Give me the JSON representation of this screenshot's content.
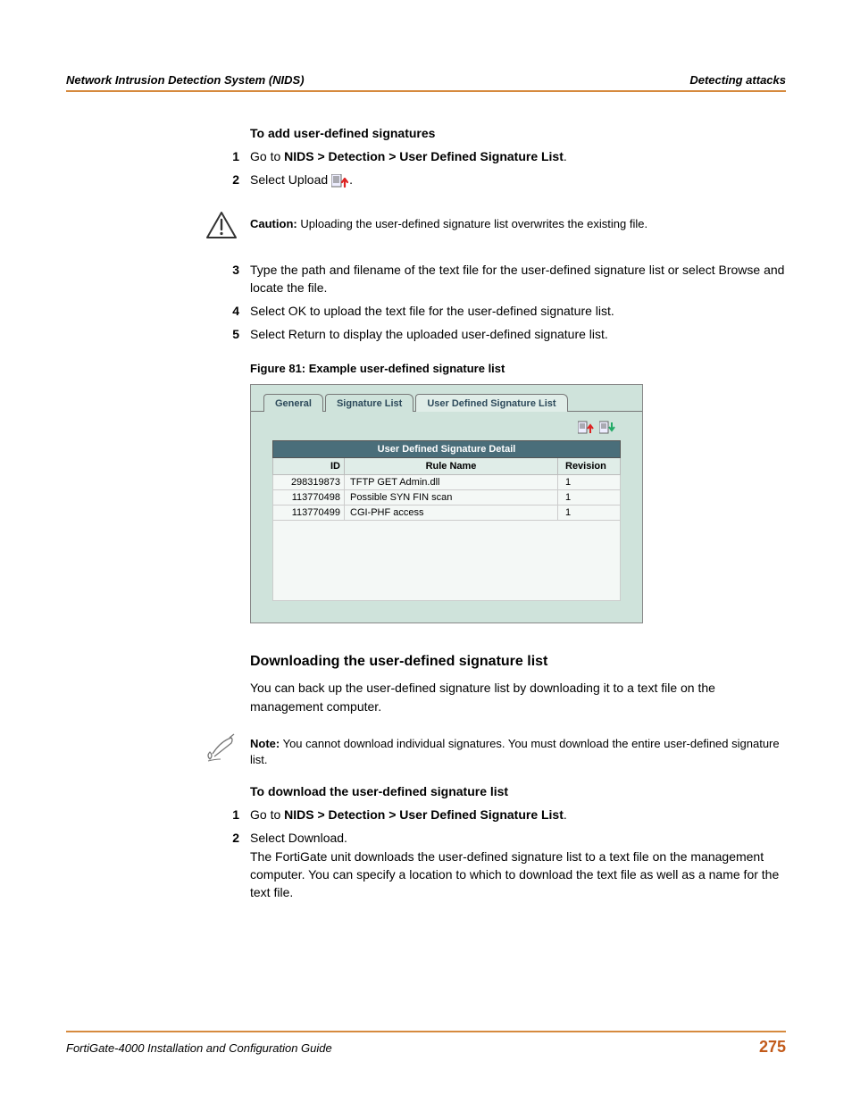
{
  "header": {
    "left": "Network Intrusion Detection System (NIDS)",
    "right": "Detecting attacks"
  },
  "sec1_title": "To add user-defined signatures",
  "steps_a": {
    "n1": "1",
    "t1a": "Go to ",
    "t1b": "NIDS > Detection > User Defined Signature List",
    "t1c": ".",
    "n2": "2",
    "t2a": "Select Upload ",
    "t2b": "."
  },
  "caution": {
    "label": "Caution:",
    "text": " Uploading the user-defined signature list overwrites the existing file."
  },
  "steps_b": {
    "n3": "3",
    "t3": "Type the path and filename of the text file for the user-defined signature list or select Browse and locate the file.",
    "n4": "4",
    "t4": "Select OK to upload the text file for the user-defined signature list.",
    "n5": "5",
    "t5": "Select Return to display the uploaded user-defined signature list."
  },
  "figure_caption": "Figure 81: Example user-defined signature list",
  "tabs": {
    "general": "General",
    "siglist": "Signature List",
    "udsl": "User Defined Signature List"
  },
  "table": {
    "title": "User Defined Signature Detail",
    "h_id": "ID",
    "h_name": "Rule Name",
    "h_rev": "Revision"
  },
  "chart_data": {
    "type": "table",
    "columns": [
      "ID",
      "Rule Name",
      "Revision"
    ],
    "rows": [
      {
        "id": "298319873",
        "name": "TFTP GET Admin.dll",
        "rev": "1"
      },
      {
        "id": "113770498",
        "name": "Possible SYN FIN scan",
        "rev": "1"
      },
      {
        "id": "113770499",
        "name": "CGI-PHF access",
        "rev": "1"
      }
    ]
  },
  "sec2_title": "Downloading the user-defined signature list",
  "sec2_para": "You can back up the user-defined signature list by downloading it to a text file on the management computer.",
  "note": {
    "label": "Note:",
    "text": " You cannot download individual signatures. You must download the entire user-defined signature list."
  },
  "sec3_title": "To download the user-defined signature list",
  "steps_c": {
    "n1": "1",
    "t1a": "Go to ",
    "t1b": "NIDS > Detection > User Defined Signature List",
    "t1c": ".",
    "n2": "2",
    "t2a": "Select Download.",
    "t2b": "The FortiGate unit downloads the user-defined signature list to a text file on the management computer. You can specify a location to which to download the text file as well as a name for the text file."
  },
  "footer": {
    "left": "FortiGate-4000 Installation and Configuration Guide",
    "page": "275"
  }
}
